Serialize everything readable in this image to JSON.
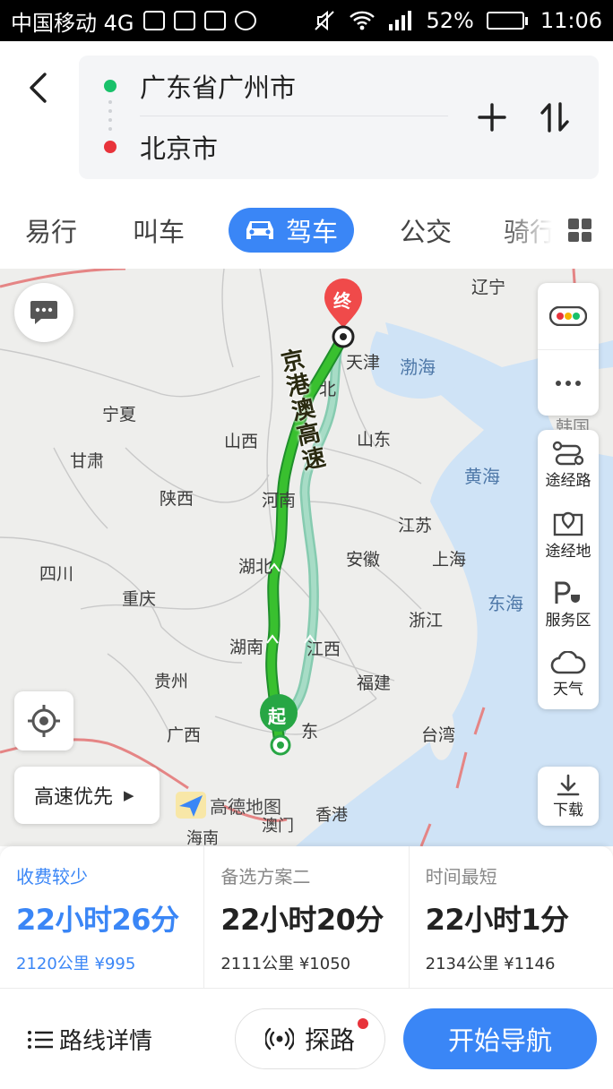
{
  "status_bar": {
    "carrier": "中国移动 4G",
    "battery": "52%",
    "battery_level": 0.52,
    "time": "11:06"
  },
  "header": {
    "origin": "广东省广州市",
    "destination": "北京市"
  },
  "tabs": [
    {
      "label": "易行"
    },
    {
      "label": "叫车"
    },
    {
      "label": "驾车",
      "active": true
    },
    {
      "label": "公交"
    },
    {
      "label": "骑行"
    }
  ],
  "map": {
    "end_marker": "终",
    "start_marker": "起",
    "highway_label": "京港澳高速",
    "labels": {
      "liaoning": "辽宁",
      "tianjin": "天津",
      "bohai": "渤海",
      "hebei": "北",
      "korea": "韩国",
      "ningxia": "宁夏",
      "shanxi": "山西",
      "shandong": "山东",
      "gansu": "甘肃",
      "huanghai": "黄海",
      "shaanxi": "陕西",
      "henan": "河南",
      "jiangsu": "江苏",
      "sichuan": "四川",
      "hubei": "湖北",
      "anhui": "安徽",
      "shanghai": "上海",
      "chongqing": "重庆",
      "zhejiang": "浙江",
      "donghai": "东海",
      "hunan": "湖南",
      "jiangxi": "江西",
      "guizhou": "贵州",
      "fujian": "福建",
      "guangxi": "广西",
      "guangdong": "东",
      "taiwan": "台湾",
      "hainan": "海南",
      "macau": "澳门",
      "hongkong": "香港"
    },
    "logo_text": "高德地图",
    "route_preference": "高速优先",
    "side_tools": [
      {
        "label": "途经路"
      },
      {
        "label": "途经地"
      },
      {
        "label": "服务区"
      },
      {
        "label": "天气"
      }
    ],
    "download_label": "下载"
  },
  "plans": [
    {
      "tag": "收费较少",
      "duration": "22小时26分",
      "meta": "2120公里 ¥995",
      "selected": true
    },
    {
      "tag": "备选方案二",
      "duration": "22小时20分",
      "meta": "2111公里 ¥1050"
    },
    {
      "tag": "时间最短",
      "duration": "22小时1分",
      "meta": "2134公里 ¥1146"
    }
  ],
  "bottom": {
    "detail": "路线详情",
    "probe": "探路",
    "navigate": "开始导航"
  },
  "colors": {
    "accent": "#3a86f6",
    "route_main": "#2fae3b",
    "route_alt": "#86cbb0",
    "origin_dot": "#19c16a",
    "dest_dot": "#e8333b"
  }
}
